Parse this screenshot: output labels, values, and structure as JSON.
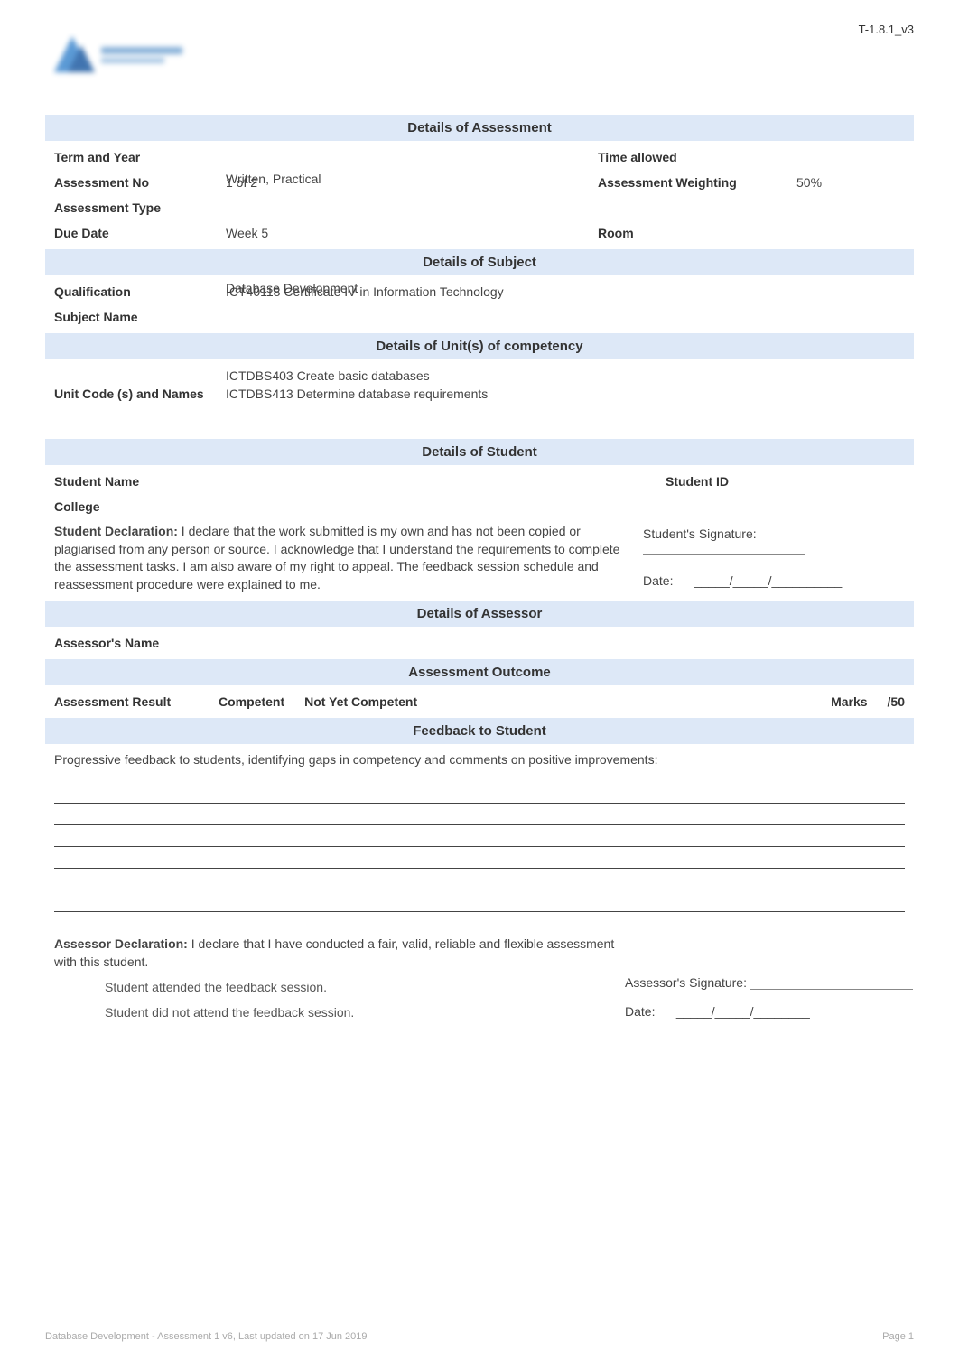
{
  "header_code": "T-1.8.1_v3",
  "sections": {
    "assessment": "Details of Assessment",
    "subject": "Details of Subject",
    "competency": "Details of Unit(s) of competency",
    "student": "Details of Student",
    "assessor": "Details of Assessor",
    "outcome": "Assessment Outcome",
    "feedback": "Feedback to Student"
  },
  "assessment": {
    "term_year_label": "Term and Year",
    "term_year_value": "",
    "time_allowed_label": "Time allowed",
    "time_allowed_value": "",
    "assessment_no_label": "Assessment No",
    "assessment_no_under": "1 of 2",
    "assessment_no_over": "Written, Practical",
    "weighting_label": "Assessment Weighting",
    "weighting_value": "50%",
    "assessment_type_label": "Assessment Type",
    "due_date_label": "Due Date",
    "due_date_value": "Week 5",
    "room_label": "Room",
    "room_value": ""
  },
  "subject": {
    "qualification_label": "Qualification",
    "qualification_under": "ICT40118  Certificate IV in Information Technology",
    "qualification_over": "Database Development",
    "subject_name_label": "Subject Name"
  },
  "competency": {
    "unit_label": "Unit Code (s) and Names",
    "units": [
      "ICTDBS403 Create basic databases",
      "ICTDBS413 Determine database requirements"
    ]
  },
  "student": {
    "name_label": "Student Name",
    "id_label": "Student ID",
    "college_label": "College",
    "declaration_title": "Student Declaration:",
    "declaration_text": " I declare that the work submitted is my own and has not been copied or plagiarised from any person or source. I acknowledge that I understand the requirements to complete the assessment tasks. I am also aware of my right to appeal. The feedback session schedule and reassessment procedure were explained to me.",
    "signature_label": "Student's Signature:",
    "date_label": "Date:",
    "date_format": "_____/_____/__________"
  },
  "assessor": {
    "name_label": "Assessor's Name"
  },
  "outcome": {
    "result_label": "Assessment Result",
    "competent": "Competent",
    "not_yet": "Not Yet Competent",
    "marks_label": "Marks",
    "marks_total": "/50"
  },
  "feedback": {
    "intro": "Progressive feedback to students, identifying gaps in competency and comments on positive improvements:"
  },
  "assessor_declaration": {
    "title": "Assessor Declaration:",
    "text": "  I declare that I have conducted a fair, valid, reliable and flexible assessment with this student.",
    "attended": "Student attended the feedback session.",
    "not_attended": "Student did not attend the feedback session.",
    "signature_label": "Assessor's Signature:",
    "date_label": "Date:",
    "date_format": "_____/_____/________"
  },
  "footer": {
    "left": "Database Development - Assessment 1 v6, Last updated on 17 Jun 2019",
    "right": "Page 1"
  }
}
